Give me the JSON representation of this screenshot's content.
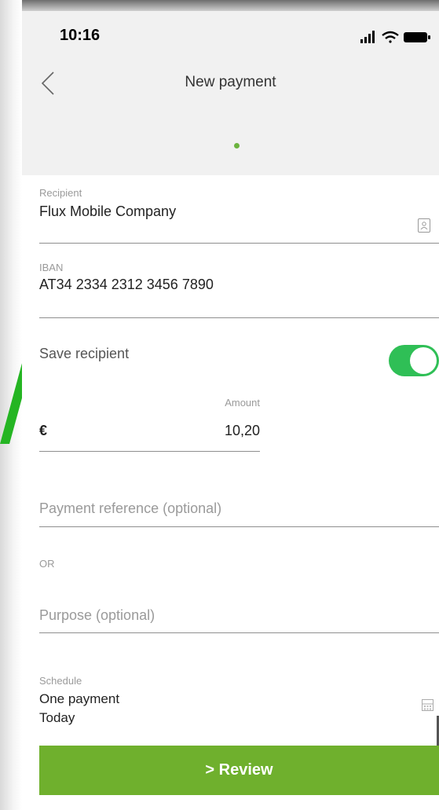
{
  "status_bar": {
    "time": "10:16"
  },
  "header": {
    "title": "New payment",
    "back_icon": "chevron-left-icon"
  },
  "recipient": {
    "label": "Recipient",
    "value": "Flux Mobile Company",
    "icon": "contact-book-icon"
  },
  "iban": {
    "label": "IBAN",
    "value": "AT34 2334 2312 3456 7890"
  },
  "save_recipient": {
    "label": "Save recipient",
    "enabled": true
  },
  "amount": {
    "label": "Amount",
    "currency": "€",
    "value": "10,20"
  },
  "payment_reference": {
    "placeholder": "Payment reference (optional)"
  },
  "or_text": "OR",
  "purpose": {
    "placeholder": "Purpose (optional)"
  },
  "schedule": {
    "label": "Schedule",
    "frequency": "One payment",
    "date": "Today",
    "icon": "calendar-icon"
  },
  "review_button": {
    "label": "> Review"
  },
  "colors": {
    "accent": "#6fb02d",
    "toggle": "#2fbf56",
    "dot": "#6cb33f"
  }
}
